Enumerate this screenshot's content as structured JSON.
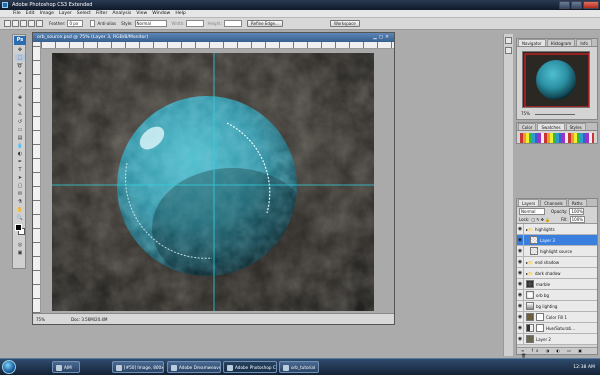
{
  "window": {
    "title": "Adobe Photoshop CS3 Extended"
  },
  "menu": [
    "File",
    "Edit",
    "Image",
    "Layer",
    "Select",
    "Filter",
    "Analysis",
    "View",
    "Window",
    "Help"
  ],
  "options": {
    "feather_label": "Feather:",
    "feather_value": "0 px",
    "antialias_label": "Anti-alias",
    "style_label": "Style:",
    "style_value": "Normal",
    "width_label": "Width:",
    "height_label": "Height:",
    "refine_label": "Refine Edge...",
    "workspace_label": "Workspace"
  },
  "document": {
    "title": "orb_source.psd @ 75% (Layer 3, RGB/8/Monitor)",
    "zoom": "75%",
    "doc_size": "Doc: 3.56M/20.4M"
  },
  "navigator": {
    "tabs": [
      "Navigator",
      "Histogram",
      "Info"
    ],
    "zoom": "75%"
  },
  "swatches": {
    "tabs": [
      "Color",
      "Swatches",
      "Styles"
    ]
  },
  "layers_panel": {
    "tabs": [
      "Layers",
      "Channels",
      "Paths"
    ],
    "blend": "Normal",
    "opacity_label": "Opacity:",
    "opacity": "100%",
    "lock_label": "Lock:",
    "fill_label": "Fill:",
    "fill": "100%",
    "layers": [
      {
        "name": "highlights",
        "kind": "group"
      },
      {
        "name": "Layer 3",
        "kind": "layer",
        "selected": true
      },
      {
        "name": "highlight source",
        "kind": "layer"
      },
      {
        "name": "end shadow",
        "kind": "group"
      },
      {
        "name": "dark shadow",
        "kind": "group"
      },
      {
        "name": "marble",
        "kind": "layer"
      },
      {
        "name": "orb bg",
        "kind": "layer"
      },
      {
        "name": "bg lighting",
        "kind": "layer"
      },
      {
        "name": "Color Fill 1",
        "kind": "fill"
      },
      {
        "name": "Hue/Saturati...",
        "kind": "adjust"
      },
      {
        "name": "Layer 2",
        "kind": "layer"
      }
    ]
  },
  "taskbar": {
    "items": [
      "AIM",
      "[#50] Image, 800x48...",
      "Adobe Dreamweave...",
      "Adobe Photoshop C...",
      "orb_tutorial"
    ],
    "active_index": 3,
    "clock": "12:38 AM"
  },
  "colors": {
    "orb": "#3aa6b8",
    "guide": "#2fd3e0",
    "titlebar": "#1b2a40"
  }
}
